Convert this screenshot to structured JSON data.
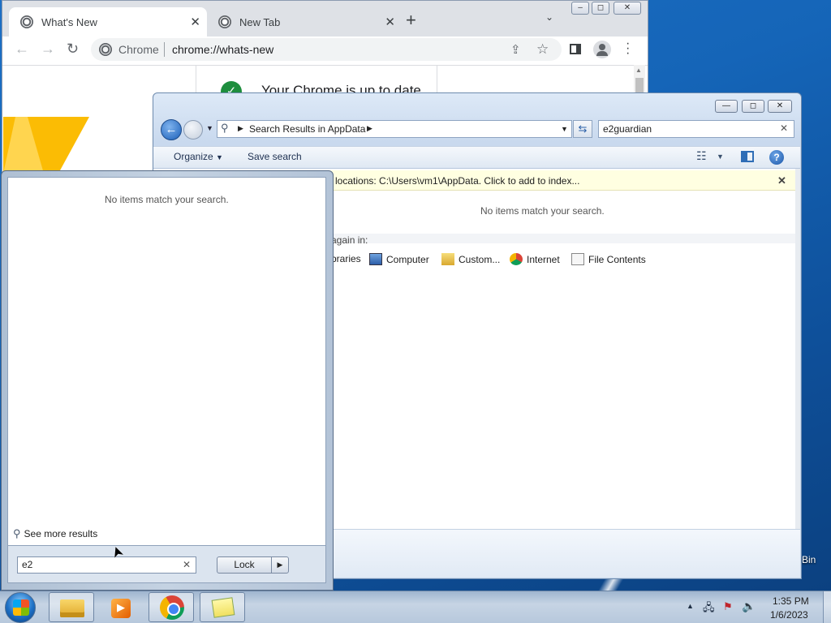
{
  "desktop": {
    "recycle_bin_label": "Bin"
  },
  "chrome": {
    "tabs": [
      {
        "label": "What's New",
        "active": true
      },
      {
        "label": "New Tab",
        "active": false
      }
    ],
    "window_controls": [
      "▭",
      "◻",
      "✕"
    ],
    "omnibox": {
      "site_label": "Chrome",
      "url": "chrome://whats-new"
    },
    "page": {
      "status_text": "Your Chrome is up to date"
    }
  },
  "explorer": {
    "title_controls": [
      "—",
      "◻",
      "✕"
    ],
    "address": {
      "breadcrumb": "Search Results in AppData"
    },
    "search": {
      "value": "e2guardian"
    },
    "command_bar": {
      "organize_label": "Organize",
      "save_search_label": "Save search"
    },
    "infobar": {
      "text": "locations: C:\\Users\\vm1\\AppData. Click to add to index..."
    },
    "empty_message": "No items match your search.",
    "search_again": {
      "label": "again in:",
      "locations": [
        "braries",
        "Computer",
        "Custom...",
        "Internet",
        "File Contents"
      ]
    }
  },
  "start_menu": {
    "empty_message": "No items match your search.",
    "see_more_label": "See more results",
    "search": {
      "value": "e2"
    },
    "power_button_label": "Lock"
  },
  "taskbar": {
    "clock": {
      "time": "1:35 PM",
      "date": "1/6/2023"
    },
    "pinned": [
      "windows-explorer",
      "windows-media-player",
      "google-chrome",
      "sticky-notes"
    ]
  },
  "colors": {
    "accent": "#1d6fc4",
    "infobar": "#ffffe1",
    "chrome_check": "#1e8e3e"
  }
}
